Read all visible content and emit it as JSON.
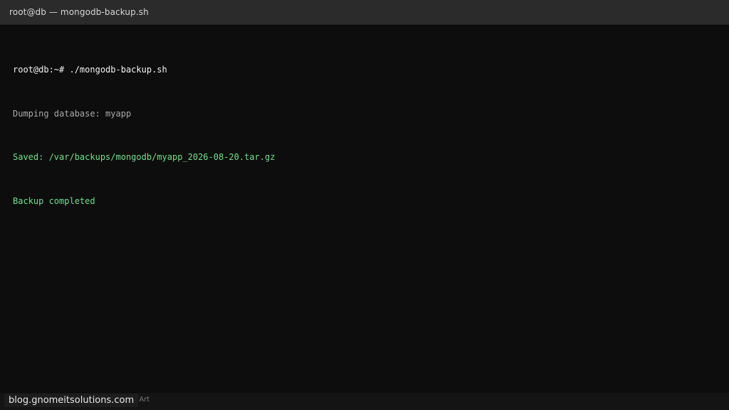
{
  "window": {
    "title": "root@db — mongodb-backup.sh"
  },
  "terminal": {
    "prompt": "root@db:~# ",
    "command": "./mongodb-backup.sh",
    "lines": [
      {
        "text": "Dumping database: myapp",
        "kind": "output"
      },
      {
        "text": "Saved: /var/backups/mongodb/myapp_2026-08-20.tar.gz",
        "kind": "success"
      },
      {
        "text": "Backup completed",
        "kind": "success"
      }
    ]
  },
  "footer": {
    "caption": "utorial Art",
    "watermark": "blog.gnomeitsolutions.com"
  },
  "colors": {
    "background": "#0d0d0d",
    "titlebar": "#2b2b2b",
    "prompt_text": "#f2f2f2",
    "output_text": "#a9a9a9",
    "success_text": "#6fe08a"
  }
}
